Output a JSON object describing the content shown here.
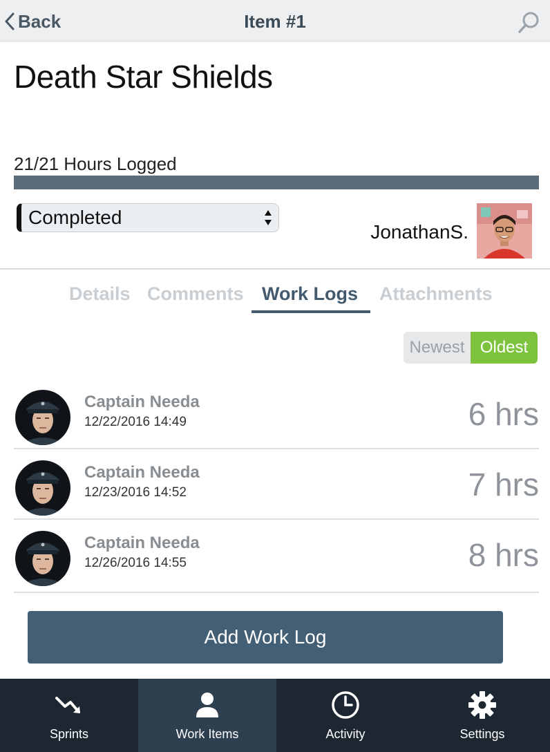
{
  "navbar": {
    "back_label": "Back",
    "title": "Item #1",
    "search_icon": "search-icon"
  },
  "item": {
    "title": "Death Star Shields",
    "hours_logged_text": "21/21 Hours Logged",
    "progress_fraction": 1.0,
    "status": "Completed",
    "assignee_name": "JonathanS."
  },
  "tabs": [
    {
      "label": "Details",
      "active": false
    },
    {
      "label": "Comments",
      "active": false
    },
    {
      "label": "Work Logs",
      "active": true
    },
    {
      "label": "Attachments",
      "active": false
    }
  ],
  "sort": {
    "newest_label": "Newest",
    "oldest_label": "Oldest",
    "selected": "Oldest"
  },
  "work_logs": [
    {
      "name": "Captain Needa",
      "date": "12/22/2016 14:49",
      "hours": "6 hrs"
    },
    {
      "name": "Captain Needa",
      "date": "12/23/2016 14:52",
      "hours": "7 hrs"
    },
    {
      "name": "Captain Needa",
      "date": "12/26/2016 14:55",
      "hours": "8 hrs"
    }
  ],
  "add_button_label": "Add Work Log",
  "tabbar": [
    {
      "label": "Sprints",
      "icon": "trend-down-icon",
      "active": false
    },
    {
      "label": "Work Items",
      "icon": "person-icon",
      "active": true
    },
    {
      "label": "Activity",
      "icon": "clock-icon",
      "active": false
    },
    {
      "label": "Settings",
      "icon": "gear-icon",
      "active": false
    }
  ],
  "colors": {
    "accent": "#435a6e",
    "oldest_active": "#7dc33e",
    "tabbar_bg": "#1d2731",
    "tabbar_active_bg": "#2e3f50"
  }
}
